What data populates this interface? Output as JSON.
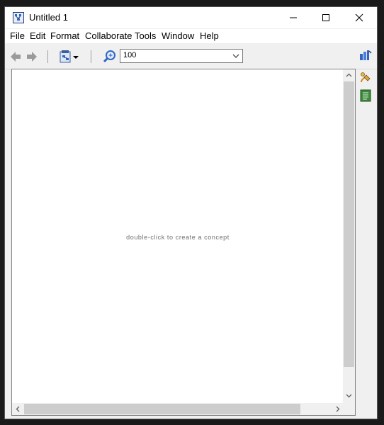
{
  "window": {
    "title": "Untitled 1",
    "controls": {
      "minimize_icon": "minimize-icon",
      "maximize_icon": "maximize-icon",
      "close_icon": "close-icon"
    }
  },
  "menubar": {
    "items": [
      {
        "label": "File"
      },
      {
        "label": "Edit"
      },
      {
        "label": "Format"
      },
      {
        "label": "Collaborate"
      },
      {
        "label": "Tools"
      },
      {
        "label": "Window"
      },
      {
        "label": "Help"
      }
    ]
  },
  "toolbar": {
    "back_icon": "back-arrow-icon",
    "forward_icon": "forward-arrow-icon",
    "view_menu_icon": "page-view-icon",
    "zoom_icon": "zoom-magnifier-icon",
    "zoom_value": "100"
  },
  "canvas": {
    "hint": "double-click to create a concept"
  },
  "side_panel": {
    "icons": [
      "cmap-tools-icon",
      "style-brush-icon",
      "notes-book-icon"
    ]
  },
  "colors": {
    "accent_blue": "#2f66c4",
    "scrollbar_thumb": "#cdcdcd",
    "arrow_gray": "#9a9a9a"
  }
}
